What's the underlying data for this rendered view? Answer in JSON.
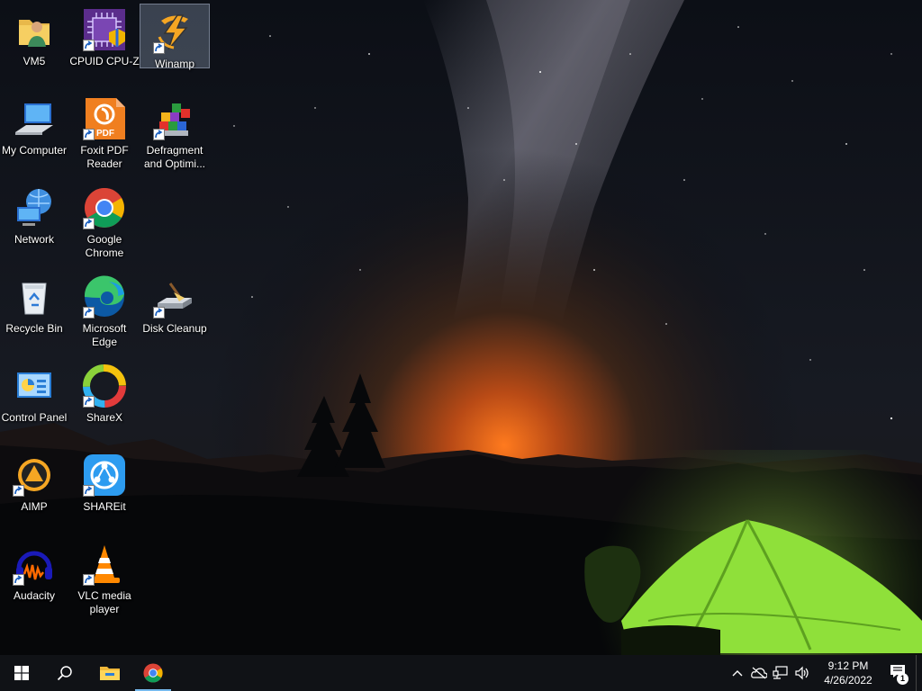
{
  "desktop": {
    "icons": [
      {
        "label": "VM5",
        "icon": "user-folder-icon",
        "shortcut": false
      },
      {
        "label": "CPUID CPU-Z",
        "icon": "cpu-z-icon",
        "shortcut": true
      },
      {
        "label": "Winamp",
        "icon": "winamp-icon",
        "shortcut": true,
        "selected": true
      },
      {
        "label": "My Computer",
        "icon": "computer-icon",
        "shortcut": false
      },
      {
        "label": "Foxit PDF Reader",
        "icon": "foxit-pdf-icon",
        "shortcut": true
      },
      {
        "label": "Defragment and Optimi...",
        "icon": "defragment-icon",
        "shortcut": true
      },
      {
        "label": "Network",
        "icon": "network-icon",
        "shortcut": false
      },
      {
        "label": "Google Chrome",
        "icon": "chrome-icon",
        "shortcut": true
      },
      {
        "label": "Recycle Bin",
        "icon": "recycle-bin-icon",
        "shortcut": false
      },
      {
        "label": "Microsoft Edge",
        "icon": "edge-icon",
        "shortcut": true
      },
      {
        "label": "Disk Cleanup",
        "icon": "disk-cleanup-icon",
        "shortcut": true
      },
      {
        "label": "Control Panel",
        "icon": "control-panel-icon",
        "shortcut": false
      },
      {
        "label": "ShareX",
        "icon": "sharex-icon",
        "shortcut": true
      },
      {
        "label": "AIMP",
        "icon": "aimp-icon",
        "shortcut": true
      },
      {
        "label": "SHAREit",
        "icon": "shareit-icon",
        "shortcut": true
      },
      {
        "label": "Audacity",
        "icon": "audacity-icon",
        "shortcut": true
      },
      {
        "label": "VLC media player",
        "icon": "vlc-icon",
        "shortcut": true
      }
    ]
  },
  "taskbar": {
    "start": "windows-start-icon",
    "search": "search-icon",
    "pinned": [
      {
        "name": "file-explorer",
        "icon": "folder-icon",
        "active": false
      },
      {
        "name": "google-chrome",
        "icon": "chrome-icon",
        "active": true
      }
    ],
    "tray": {
      "icons": [
        "chevron-up-icon",
        "onedrive-offline-icon",
        "network-icon",
        "volume-icon"
      ],
      "time": "9:12 PM",
      "date": "4/26/2022",
      "notification_count": "1"
    }
  },
  "colors": {
    "taskbar": "#101216",
    "tent": "#8fe03a",
    "horizon_glow": "#e5651a"
  }
}
